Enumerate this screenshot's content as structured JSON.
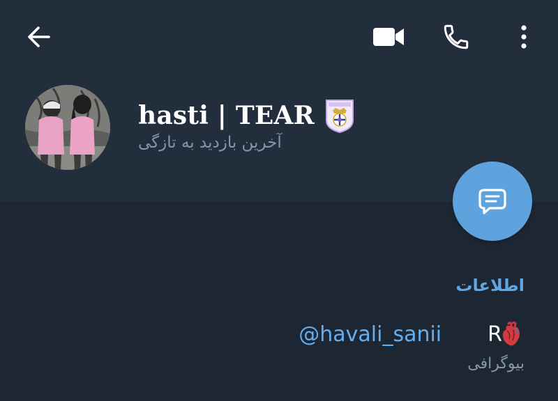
{
  "header": {
    "icons": {
      "back": "arrow-left-icon",
      "video": "video-camera-icon",
      "call": "phone-icon",
      "more": "more-vertical-icon"
    }
  },
  "profile": {
    "name": "hasti | TEAR",
    "badge_icon": "real-madrid-crest-icon",
    "status": "آخرین بازدید به تازگی"
  },
  "fab": {
    "icon": "message-icon",
    "color": "#5fa3de"
  },
  "info": {
    "section_title": "اطلاعات",
    "bio_text": "R",
    "bio_emoji": "anatomical-heart-icon",
    "bio_mention": "@havali_sanii",
    "bio_label": "بیوگرافی"
  },
  "colors": {
    "background": "#1d2733",
    "header": "#232e3c",
    "accent": "#5ea7e3",
    "secondary_text": "#8496a8"
  }
}
